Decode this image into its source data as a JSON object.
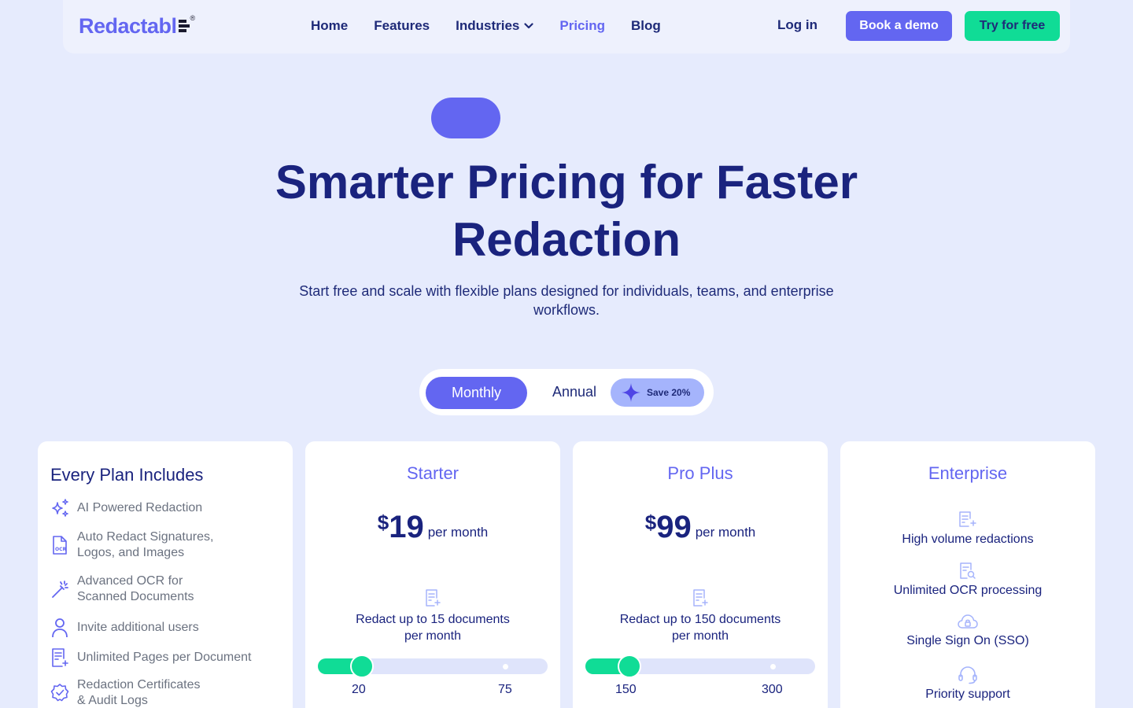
{
  "header": {
    "logo": "Redactabl",
    "logo_reg": "®",
    "nav": [
      "Home",
      "Features",
      "Industries",
      "Pricing",
      "Blog"
    ],
    "login": "Log in",
    "book_demo": "Book a demo",
    "try_free": "Try for free"
  },
  "hero": {
    "title": "Smarter Pricing for Faster Redaction",
    "subtitle": "Start free and scale with flexible plans designed for individuals, teams, and enterprise workflows."
  },
  "billing_toggle": {
    "monthly": "Monthly",
    "annual": "Annual",
    "save": "Save 20%",
    "selected": "Monthly"
  },
  "includes": {
    "title": "Every Plan Includes",
    "items": [
      {
        "icon": "sparkles-icon",
        "l1": "AI Powered Redaction",
        "l2": ""
      },
      {
        "icon": "ocr-file-icon",
        "l1": "Auto Redact Signatures,",
        "l2": "Logos, and Images"
      },
      {
        "icon": "magic-wand-icon",
        "l1": "Advanced OCR for",
        "l2": "Scanned Documents"
      },
      {
        "icon": "user-icon",
        "l1": "Invite additional users",
        "l2": ""
      },
      {
        "icon": "document-plus-icon",
        "l1": "Unlimited Pages per Document",
        "l2": ""
      },
      {
        "icon": "badge-check-icon",
        "l1": "Redaction Certificates",
        "l2": "& Audit Logs"
      }
    ]
  },
  "plans": [
    {
      "name": "Starter",
      "currency": "$",
      "price": "19",
      "period": "per month",
      "limit_l1": "Redact up to 15 documents",
      "limit_l2": "per month",
      "ticks": [
        "20",
        "75"
      ],
      "slider_value": 20
    },
    {
      "name": "Pro Plus",
      "currency": "$",
      "price": "99",
      "period": "per month",
      "limit_l1": "Redact up to 150 documents",
      "limit_l2": "per month",
      "ticks": [
        "150",
        "300"
      ],
      "slider_value": 150
    }
  ],
  "enterprise": {
    "name": "Enterprise",
    "features": [
      {
        "icon": "document-plus-icon",
        "label": "High volume redactions"
      },
      {
        "icon": "document-search-icon",
        "label": "Unlimited OCR processing"
      },
      {
        "icon": "cloud-lock-icon",
        "label": "Single Sign On (SSO)"
      },
      {
        "icon": "headset-icon",
        "label": "Priority support"
      }
    ]
  },
  "colors": {
    "accent": "#6366f1",
    "green": "#10dc96",
    "navy": "#1a237e",
    "background": "#e6ebfd"
  }
}
